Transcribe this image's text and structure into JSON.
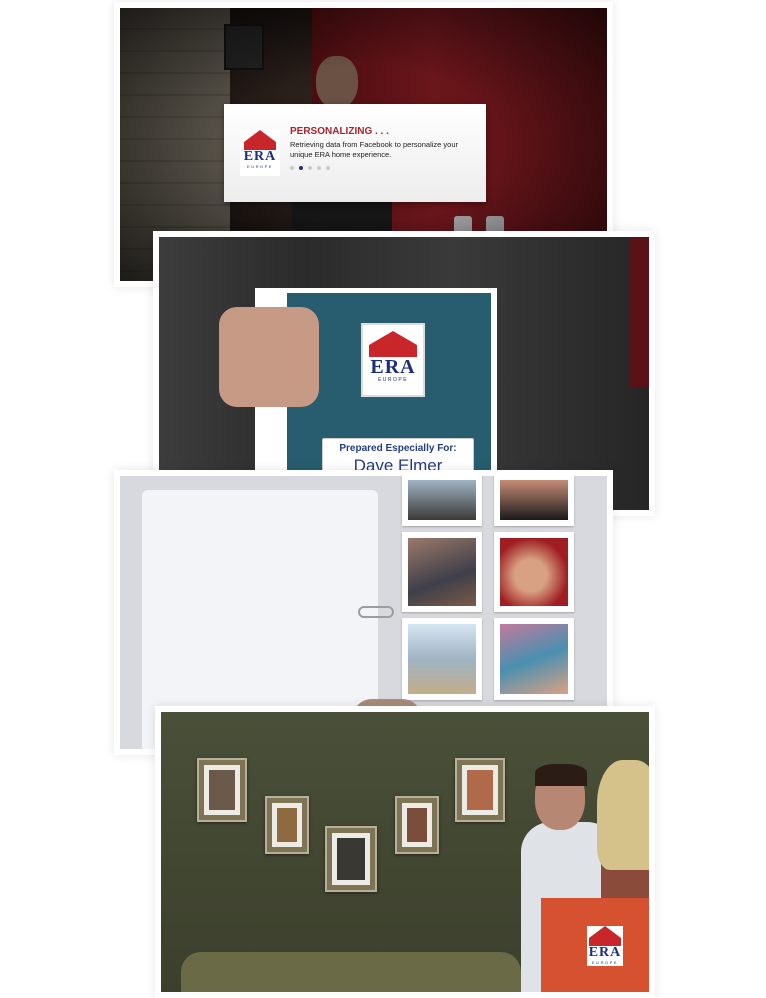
{
  "card": {
    "title": "PERSONALIZING . . .",
    "body": "Retrieving data from Facebook to personalize your unique ERA home experience.",
    "logo_text": "ERA",
    "logo_sub": "EUROPE",
    "progress_dots": 5,
    "active_dot": 2
  },
  "binder": {
    "logo_text": "ERA",
    "logo_sub": "EUROPE",
    "label_prefix": "Prepared Especially For:",
    "label_name": "Dave Elmer"
  },
  "sign": {
    "logo_text": "ERA",
    "logo_sub": "EUROPE"
  },
  "colors": {
    "era_red": "#c9262c",
    "era_blue": "#1c2f7a",
    "binder_teal": "#275d6f",
    "sign_orange": "#d5512f"
  }
}
